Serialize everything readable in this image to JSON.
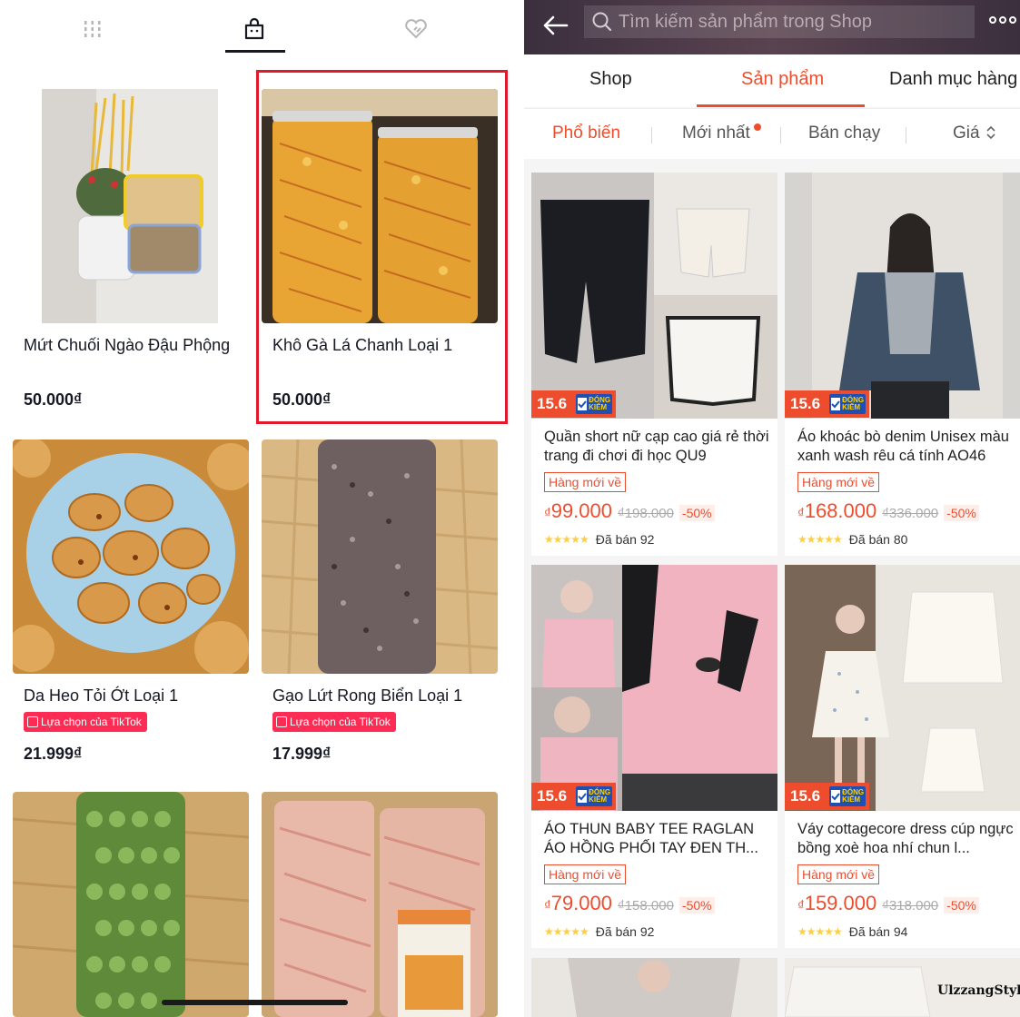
{
  "left_panel": {
    "tabs": [
      {
        "icon": "grid-icon"
      },
      {
        "icon": "shopping-bag-icon"
      },
      {
        "icon": "heart-icon"
      }
    ],
    "products": [
      {
        "name": "Mứt Chuối Ngào Đậu Phộng",
        "price": "50.000₫"
      },
      {
        "name": "Khô Gà Lá Chanh Loại 1",
        "price": "50.000₫"
      },
      {
        "name": "Da Heo Tỏi Ớt Loại 1",
        "badge": "Lựa chọn của TikTok",
        "price": "21.999₫"
      },
      {
        "name": "Gạo Lứt Rong Biển Loại 1",
        "badge": "Lựa chọn của TikTok",
        "price": "17.999₫"
      },
      {},
      {}
    ]
  },
  "right_panel": {
    "search": {
      "placeholder": "Tìm kiếm sản phẩm trong Shop"
    },
    "tabs": [
      "Shop",
      "Sản phẩm",
      "Danh mục hàng"
    ],
    "sort": [
      "Phổ biến",
      "Mới nhất",
      "Bán chạy",
      "Giá"
    ],
    "products": [
      {
        "title": "Quần short nữ cạp cao giá rẻ thời trang đi chơi đi học QU9",
        "promo": "15.6",
        "promo_badge": "ĐÓNG KIỂM",
        "tag": "Hàng mới về",
        "currency": "₫",
        "price": "99.000",
        "old_price": "₫198.000",
        "discount": "-50%",
        "sold": "Đã bán 92"
      },
      {
        "title": "Áo khoác bò denim Unisex màu xanh wash rêu cá tính AO46",
        "promo": "15.6",
        "promo_badge": "ĐÓNG KIỂM",
        "tag": "Hàng mới về",
        "currency": "₫",
        "price": "168.000",
        "old_price": "₫336.000",
        "discount": "-50%",
        "sold": "Đã bán 80"
      },
      {
        "title": "ÁO THUN BABY TEE RAGLAN ÁO HỒNG PHỐI TAY ĐEN TH...",
        "promo": "15.6",
        "promo_badge": "ĐÓNG KIỂM",
        "tag": "Hàng mới về",
        "currency": "₫",
        "price": "79.000",
        "old_price": "₫158.000",
        "discount": "-50%",
        "sold": "Đã bán 92"
      },
      {
        "title": "Váy cottagecore dress cúp ngực bồng xoè hoa nhí chun l...",
        "promo": "15.6",
        "promo_badge": "ĐÓNG KIỂM",
        "tag": "Hàng mới về",
        "currency": "₫",
        "price": "159.000",
        "old_price": "₫318.000",
        "discount": "-50%",
        "sold": "Đã bán 94"
      }
    ],
    "watermark": "UlzzangStyle",
    "colors": {
      "accent": "#ee4d2d",
      "header": "#4a3a45"
    }
  }
}
